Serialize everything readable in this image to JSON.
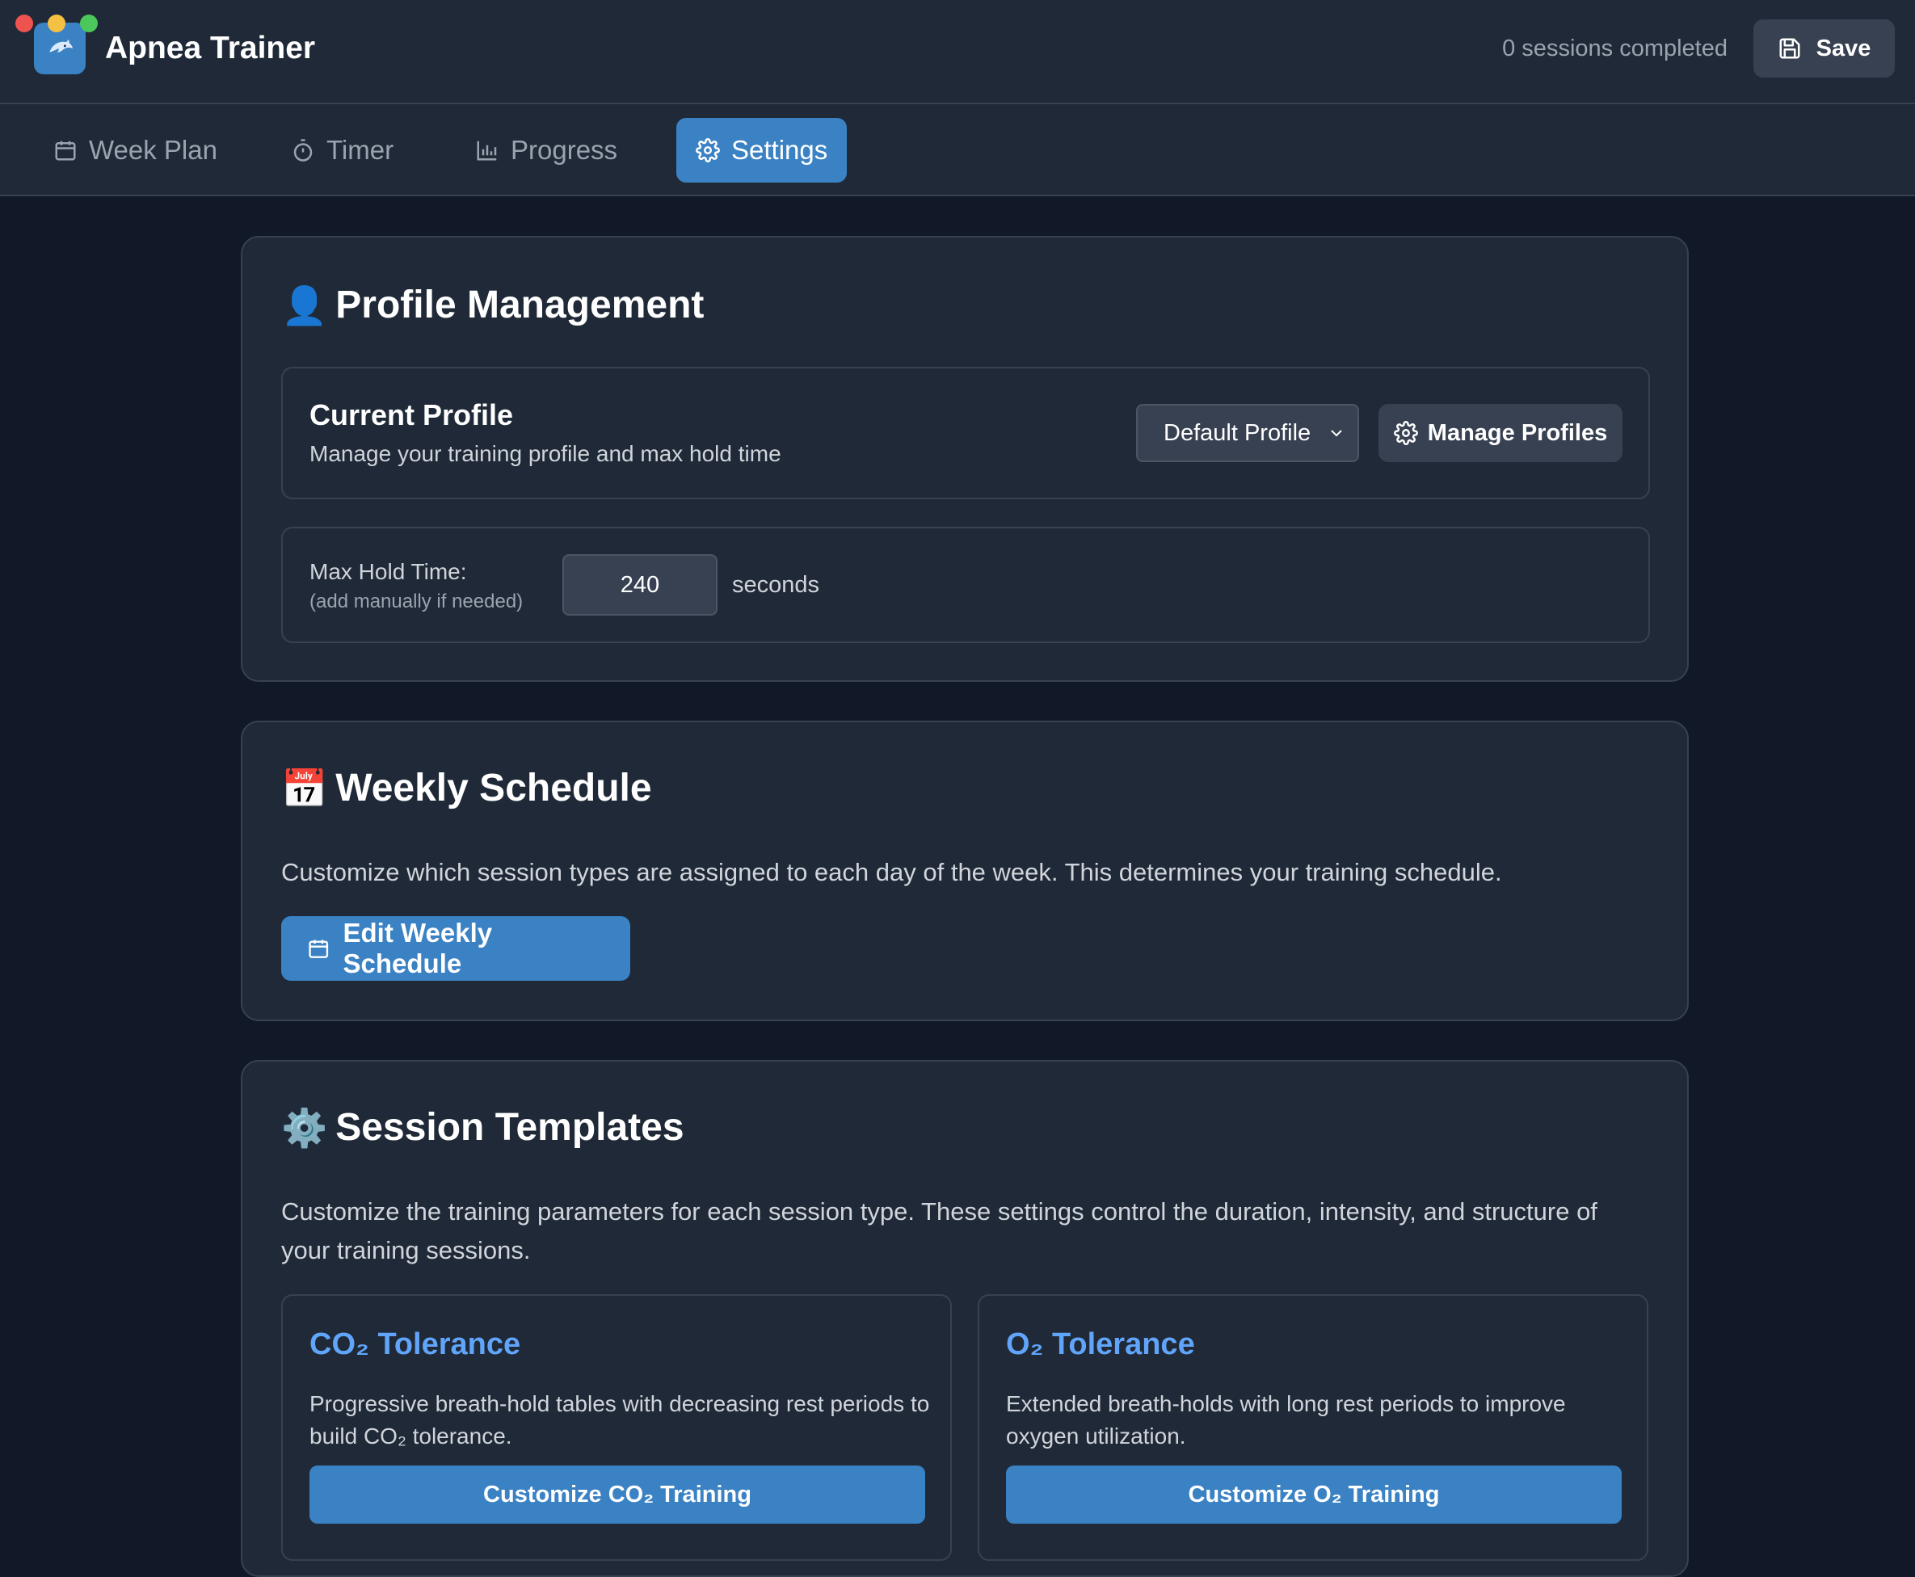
{
  "window": {
    "controls": [
      "close",
      "minimize",
      "maximize"
    ]
  },
  "header": {
    "app_title": "Apnea Trainer",
    "logo_icon": "dolphin-icon",
    "sessions_completed": "0 sessions completed",
    "save_label": "Save"
  },
  "tabs": [
    {
      "label": "Week Plan",
      "icon": "calendar-icon",
      "active": false
    },
    {
      "label": "Timer",
      "icon": "stopwatch-icon",
      "active": false
    },
    {
      "label": "Progress",
      "icon": "bar-chart-icon",
      "active": false
    },
    {
      "label": "Settings",
      "icon": "gear-icon",
      "active": true
    }
  ],
  "profile_section": {
    "emoji": "👤",
    "title": "Profile Management",
    "current_profile": {
      "title": "Current Profile",
      "subtitle": "Manage your training profile and max hold time",
      "selected_profile": "Default Profile",
      "manage_label": "Manage Profiles"
    },
    "max_hold": {
      "label": "Max Hold Time:",
      "hint": "(add manually if needed)",
      "value": "240",
      "unit": "seconds"
    }
  },
  "schedule_section": {
    "emoji": "📅",
    "title": "Weekly Schedule",
    "description": "Customize which session types are assigned to each day of the week. This determines your training schedule.",
    "button_label": "Edit Weekly Schedule"
  },
  "templates_section": {
    "emoji": "⚙️",
    "title": "Session Templates",
    "description": "Customize the training parameters for each session type. These settings control the duration, intensity, and structure of your training sessions.",
    "templates": [
      {
        "title": "CO₂ Tolerance",
        "description": "Progressive breath-hold tables with decreasing rest periods to build CO₂ tolerance.",
        "button_label": "Customize CO₂ Training"
      },
      {
        "title": "O₂ Tolerance",
        "description": "Extended breath-holds with long rest periods to improve oxygen utilization.",
        "button_label": "Customize O₂ Training"
      }
    ]
  },
  "colors": {
    "background": "#111827",
    "surface": "#1f2937",
    "border": "#374151",
    "accent": "#3b82c4",
    "link": "#60a5fa"
  }
}
